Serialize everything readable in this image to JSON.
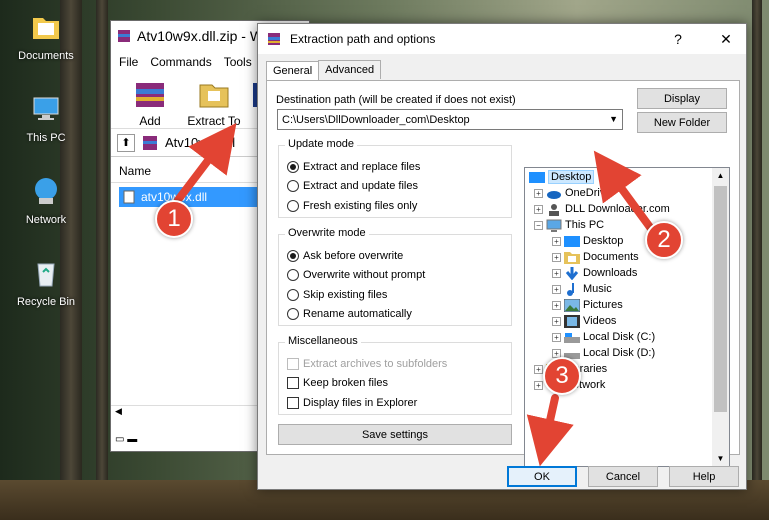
{
  "desktop": {
    "icons": [
      {
        "label": "Documents",
        "icon": "documents-folder-icon"
      },
      {
        "label": "This PC",
        "icon": "computer-icon"
      },
      {
        "label": "Network",
        "icon": "network-icon"
      },
      {
        "label": "Recycle Bin",
        "icon": "recycle-bin-icon"
      }
    ]
  },
  "winrar": {
    "title": "Atv10w9x.dll.zip - W",
    "menu": [
      "File",
      "Commands",
      "Tools"
    ],
    "tools": {
      "add": "Add",
      "extract_to": "Extract To",
      "test": "T"
    },
    "address": "Atv10w9x.dl",
    "column_name": "Name",
    "file_name": "atv10w9x.dll"
  },
  "dialog": {
    "title": "Extraction path and options",
    "help_label": "?",
    "close_label": "✕",
    "tabs": [
      "General",
      "Advanced"
    ],
    "dest_label": "Destination path (will be created if does not exist)",
    "dest_value": "C:\\Users\\DllDownloader_com\\Desktop",
    "display_button": "Display",
    "new_folder_button": "New Folder",
    "update_mode": {
      "title": "Update mode",
      "options": [
        "Extract and replace files",
        "Extract and update files",
        "Fresh existing files only"
      ],
      "selected": 0
    },
    "overwrite_mode": {
      "title": "Overwrite mode",
      "options": [
        "Ask before overwrite",
        "Overwrite without prompt",
        "Skip existing files",
        "Rename automatically"
      ],
      "selected": 0
    },
    "misc": {
      "title": "Miscellaneous",
      "options": [
        "Extract archives to subfolders",
        "Keep broken files",
        "Display files in Explorer"
      ]
    },
    "save_settings": "Save settings",
    "tree": {
      "root": "Desktop",
      "items": [
        "OneDrive",
        "DLL Downloader.com",
        "This PC",
        "Desktop",
        "Documents",
        "Downloads",
        "Music",
        "Pictures",
        "Videos",
        "Local Disk (C:)",
        "Local Disk (D:)",
        "Libraries",
        "Network"
      ]
    },
    "ok": "OK",
    "cancel": "Cancel",
    "help": "Help"
  },
  "annotations": {
    "step1": "1",
    "step2": "2",
    "step3": "3",
    "color": "#e24433"
  }
}
